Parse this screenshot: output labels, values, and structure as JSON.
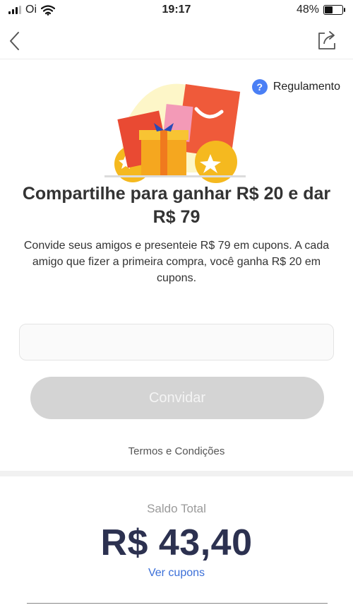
{
  "status_bar": {
    "carrier": "Oi",
    "time": "19:17",
    "battery_percent": "48%",
    "battery_level": 0.48
  },
  "header": {
    "back_icon": "chevron-left-icon",
    "share_icon": "share-icon"
  },
  "rules": {
    "icon_text": "?",
    "label": "Regulamento",
    "icon_color": "#4a7ff5"
  },
  "main": {
    "headline": "Compartilhe para ganhar R$ 20 e dar R$ 79",
    "description": "Convide seus amigos e presenteie R$ 79 em cupons. A cada amigo que fizer a primeira compra, você ganha R$ 20 em cupons.",
    "invite_input": {
      "value": "",
      "placeholder": ""
    },
    "invite_button": "Convidar",
    "terms_link": "Termos e Condições"
  },
  "balance": {
    "label": "Saldo Total",
    "amount": "R$ 43,40",
    "coupons_link": "Ver cupons"
  },
  "colors": {
    "balance_text": "#2c3150",
    "link": "#3b6fd8",
    "button_disabled": "#d4d4d4"
  }
}
